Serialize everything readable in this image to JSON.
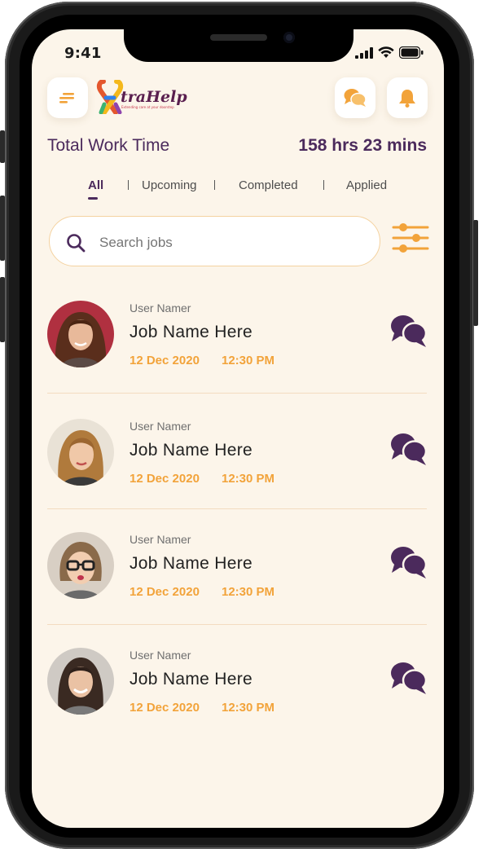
{
  "status_bar": {
    "time": "9:41"
  },
  "header": {
    "logo_text": "traHelp",
    "logo_subtitle": "Extending care at your doorstep",
    "menu_icon": "menu-icon",
    "chat_icon": "chat-bubbles-icon",
    "notification_icon": "bell-icon"
  },
  "summary": {
    "label": "Total Work Time",
    "value": "158 hrs 23 mins"
  },
  "tabs": [
    {
      "label": "All",
      "active": true
    },
    {
      "label": "Upcoming",
      "active": false
    },
    {
      "label": "Completed",
      "active": false
    },
    {
      "label": "Applied",
      "active": false
    }
  ],
  "search": {
    "placeholder": "Search jobs",
    "value": ""
  },
  "jobs": [
    {
      "user": "User Namer",
      "title": "Job Name Here",
      "date": "12 Dec 2020",
      "time": "12:30 PM"
    },
    {
      "user": "User Namer",
      "title": "Job Name Here",
      "date": "12 Dec 2020",
      "time": "12:30 PM"
    },
    {
      "user": "User Namer",
      "title": "Job Name Here",
      "date": "12 Dec 2020",
      "time": "12:30 PM"
    },
    {
      "user": "User Namer",
      "title": "Job Name Here",
      "date": "12 Dec 2020",
      "time": "12:30 PM"
    }
  ],
  "colors": {
    "background": "#fcf5ea",
    "primary": "#4b2a5c",
    "accent": "#f2a33a"
  }
}
